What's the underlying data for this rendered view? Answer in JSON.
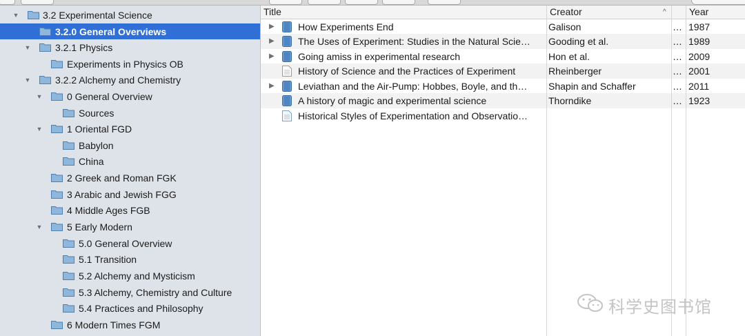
{
  "sidebar": {
    "items": [
      {
        "label": "3.2 Experimental Science",
        "disclosure": "open",
        "selected": false
      },
      {
        "label": "3.2.0 General Overviews",
        "disclosure": "none",
        "selected": true
      },
      {
        "label": "3.2.1 Physics",
        "disclosure": "open",
        "selected": false
      },
      {
        "label": "Experiments in Physics OB",
        "disclosure": "none",
        "selected": false
      },
      {
        "label": "3.2.2 Alchemy and Chemistry",
        "disclosure": "open",
        "selected": false
      },
      {
        "label": "0 General Overview",
        "disclosure": "open",
        "selected": false
      },
      {
        "label": "Sources",
        "disclosure": "none",
        "selected": false
      },
      {
        "label": "1 Oriental FGD",
        "disclosure": "open",
        "selected": false
      },
      {
        "label": "Babylon",
        "disclosure": "none",
        "selected": false
      },
      {
        "label": "China",
        "disclosure": "none",
        "selected": false
      },
      {
        "label": "2 Greek and Roman FGK",
        "disclosure": "none",
        "selected": false
      },
      {
        "label": "3 Arabic and Jewish FGG",
        "disclosure": "none",
        "selected": false
      },
      {
        "label": "4 Middle Ages FGB",
        "disclosure": "none",
        "selected": false
      },
      {
        "label": "5 Early Modern",
        "disclosure": "open",
        "selected": false
      },
      {
        "label": "5.0 General Overview",
        "disclosure": "none",
        "selected": false
      },
      {
        "label": "5.1 Transition",
        "disclosure": "none",
        "selected": false
      },
      {
        "label": "5.2 Alchemy and Mysticism",
        "disclosure": "none",
        "selected": false
      },
      {
        "label": "5.3 Alchemy, Chemistry and Culture",
        "disclosure": "none",
        "selected": false
      },
      {
        "label": "5.4 Practices and Philosophy",
        "disclosure": "none",
        "selected": false
      },
      {
        "label": "6 Modern Times FGM",
        "disclosure": "none",
        "selected": false
      }
    ]
  },
  "columns": {
    "title": "Title",
    "creator": "Creator",
    "year": "Year",
    "sort_indicator": "^"
  },
  "items": [
    {
      "title": "How Experiments End",
      "creator": "Galison",
      "extra": "…",
      "year": "1987",
      "icon": "book-icon",
      "expandable": true
    },
    {
      "title": "The Uses of Experiment: Studies in the Natural Scie…",
      "creator": "Gooding et al.",
      "extra": "…",
      "year": "1989",
      "icon": "book-icon",
      "expandable": true
    },
    {
      "title": "Going amiss in experimental research",
      "creator": "Hon et al.",
      "extra": "…",
      "year": "2009",
      "icon": "book-icon",
      "expandable": true
    },
    {
      "title": "History of Science and the Practices of Experiment",
      "creator": "Rheinberger",
      "extra": "…",
      "year": "2001",
      "icon": "document-icon",
      "expandable": false
    },
    {
      "title": "Leviathan and the Air-Pump: Hobbes, Boyle, and th…",
      "creator": "Shapin and Schaffer",
      "extra": "…",
      "year": "2011",
      "icon": "book-icon",
      "expandable": true
    },
    {
      "title": "A history of magic and experimental science",
      "creator": "Thorndike",
      "extra": "…",
      "year": "1923",
      "icon": "book-icon",
      "expandable": false
    },
    {
      "title": "Historical Styles of Experimentation and Observatio…",
      "creator": "",
      "extra": "",
      "year": "",
      "icon": "web-page-icon",
      "expandable": false
    }
  ],
  "watermark": {
    "text": "科学史图书馆",
    "icon": "wechat-icon"
  },
  "colors": {
    "selection": "#2f6fd6",
    "sidebar_bg": "#dee3ea",
    "folder": "#8fb7dc"
  }
}
